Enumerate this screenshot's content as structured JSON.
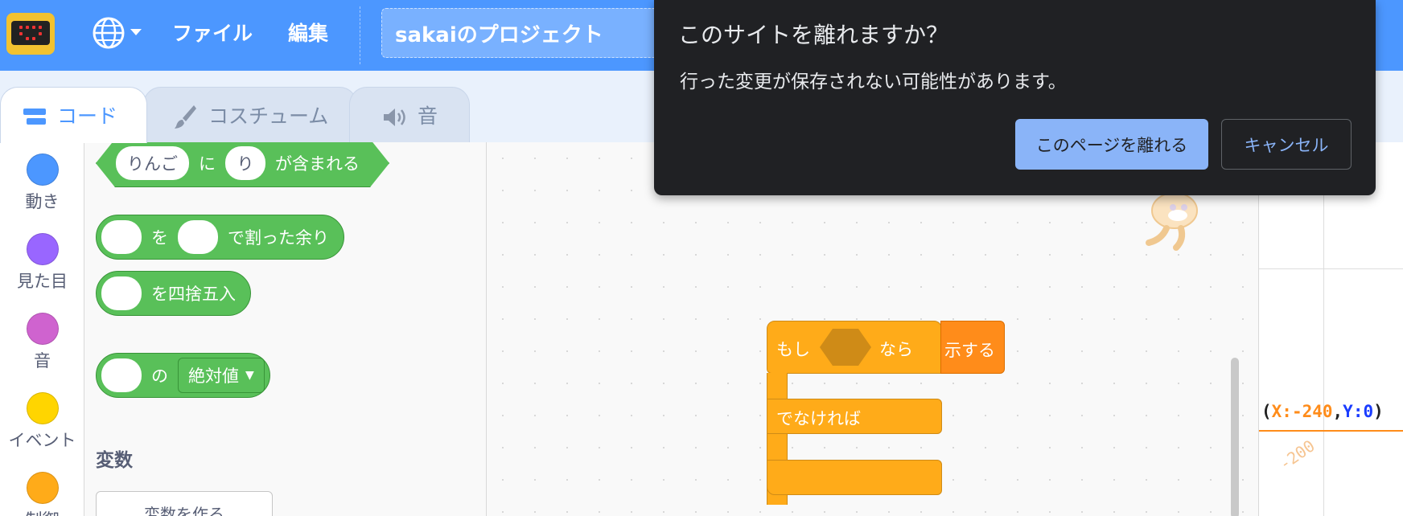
{
  "menubar": {
    "file_label": "ファイル",
    "edit_label": "編集",
    "project_title": "sakaiのプロジェクト"
  },
  "tabs": [
    {
      "label": "コード",
      "icon": "code-icon",
      "active": true
    },
    {
      "label": "コスチューム",
      "icon": "brush-icon",
      "active": false
    },
    {
      "label": "音",
      "icon": "speaker-icon",
      "active": false
    }
  ],
  "categories": [
    {
      "label": "動き",
      "color": "#4c97ff"
    },
    {
      "label": "見た目",
      "color": "#9966ff"
    },
    {
      "label": "音",
      "color": "#cf63cf"
    },
    {
      "label": "イベント",
      "color": "#ffd500"
    },
    {
      "label": "制御",
      "color": "#ffab19"
    }
  ],
  "palette": {
    "contains_block": {
      "input1": "りんご",
      "text1": "に",
      "input2": "り",
      "text2": "が含まれる"
    },
    "mod_block": {
      "text1": "を",
      "text2": "で割った余り"
    },
    "round_block": {
      "text": "を四捨五入"
    },
    "abs_block": {
      "text": "の",
      "dropdown": "絶対値"
    },
    "variables_title": "変数",
    "make_variable_label": "変数を作る"
  },
  "workspace": {
    "if_label": "もし",
    "then_label": "なら",
    "else_label": "でなければ",
    "partial_label": "示する"
  },
  "stage": {
    "coord_open": "(",
    "coord_x": "X:-240",
    "coord_sep": ",",
    "coord_y": "Y:0",
    "coord_close": ")",
    "tick_label": "-200"
  },
  "dialog": {
    "title": "このサイトを離れますか？",
    "message": "行った変更が保存されない可能性があります。",
    "leave_label": "このページを離れる",
    "cancel_label": "キャンセル"
  },
  "colors": {
    "menubar": "#4c97ff",
    "operators": "#59c059",
    "control": "#ffab19",
    "dialog_bg": "#202124",
    "dialog_accent": "#8ab4f8"
  }
}
